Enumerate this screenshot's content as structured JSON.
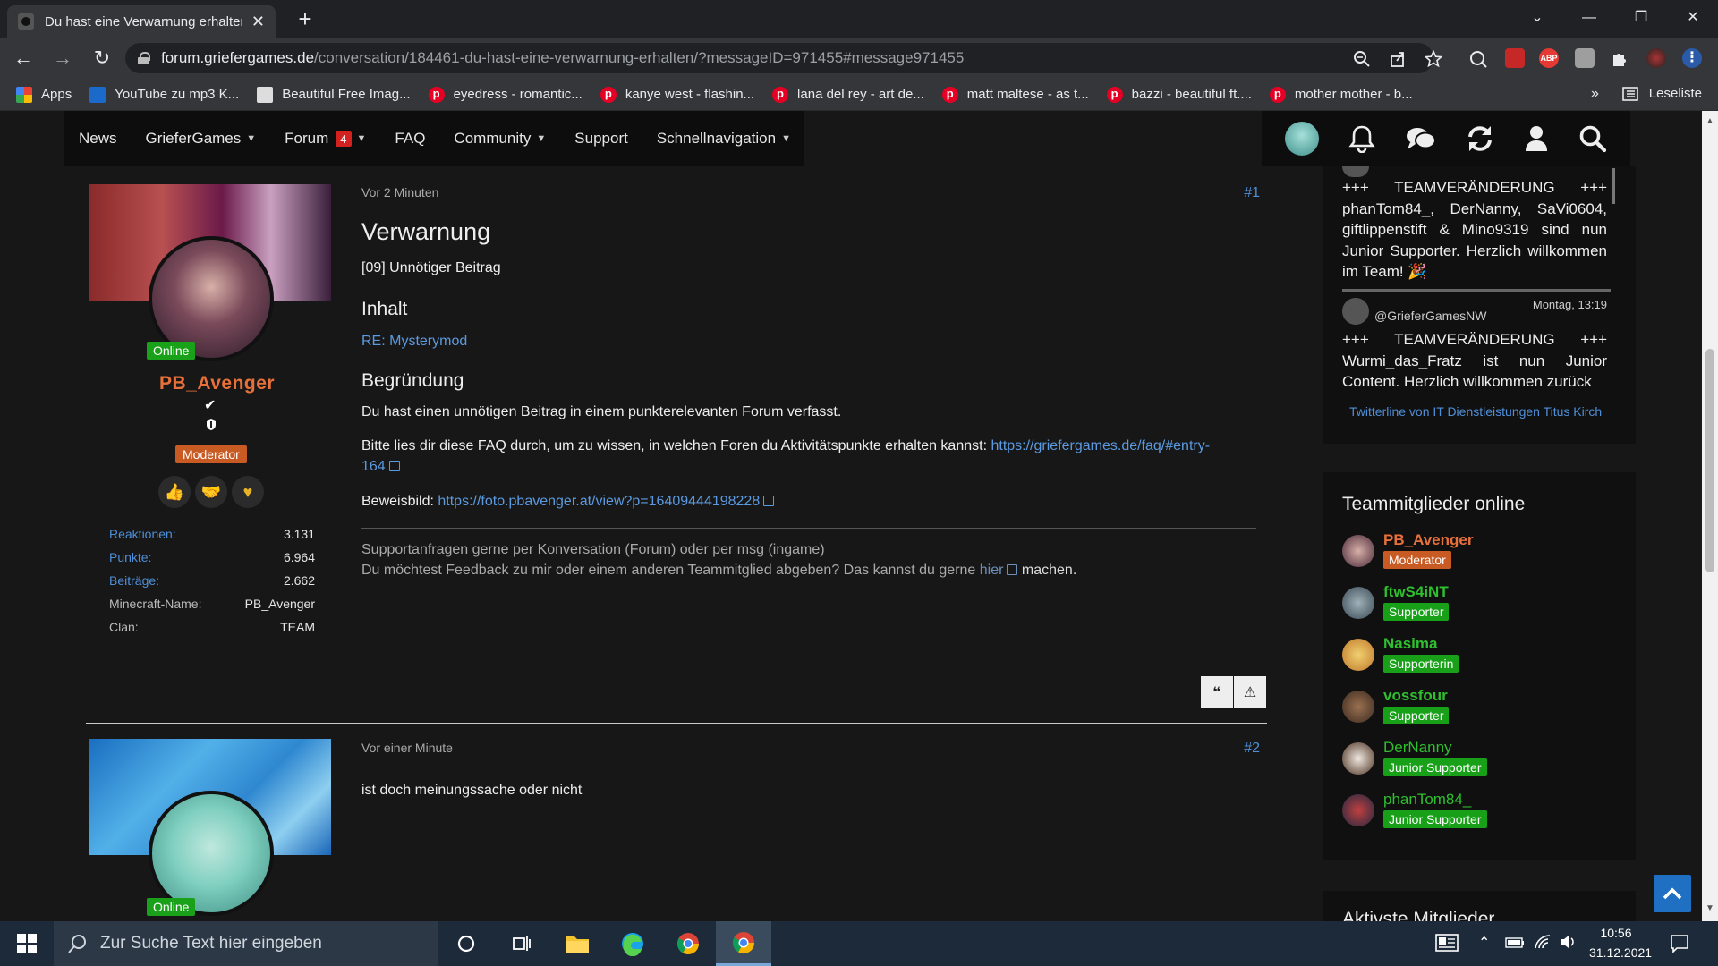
{
  "browser": {
    "tab_title": "Du hast eine Verwarnung erhalten",
    "url_host": "forum.griefergames.de",
    "url_path": "/conversation/184461-du-hast-eine-verwarnung-erhalten/?messageID=971455#message971455",
    "reading_list": "Leseliste",
    "bookmarks": [
      {
        "label": "Apps",
        "icon": "apps-grid-icon"
      },
      {
        "label": "YouTube zu mp3 K...",
        "icon": "2c-icon"
      },
      {
        "label": "Beautiful Free Imag...",
        "icon": "unsplash-icon"
      },
      {
        "label": "eyedress - romantic...",
        "icon": "pinterest-icon"
      },
      {
        "label": "kanye west - flashin...",
        "icon": "pinterest-icon"
      },
      {
        "label": "lana del rey - art de...",
        "icon": "pinterest-icon"
      },
      {
        "label": "matt maltese - as t...",
        "icon": "pinterest-icon"
      },
      {
        "label": "bazzi - beautiful ft....",
        "icon": "pinterest-icon"
      },
      {
        "label": "mother mother - b...",
        "icon": "pinterest-icon"
      }
    ],
    "bookmarks_more": "»"
  },
  "site_nav": {
    "items": [
      {
        "label": "News",
        "dropdown": false
      },
      {
        "label": "GrieferGames",
        "dropdown": true
      },
      {
        "label": "Forum",
        "dropdown": true,
        "badge": "4"
      },
      {
        "label": "FAQ",
        "dropdown": false
      },
      {
        "label": "Community",
        "dropdown": true
      },
      {
        "label": "Support",
        "dropdown": false
      },
      {
        "label": "Schnellnavigation",
        "dropdown": true
      }
    ]
  },
  "post1": {
    "time": "Vor 2 Minuten",
    "number": "#1",
    "online": "Online",
    "username": "PB_Avenger",
    "role": "Moderator",
    "stats": [
      {
        "k": "Reaktionen:",
        "v": "3.131"
      },
      {
        "k": "Punkte:",
        "v": "6.964"
      },
      {
        "k": "Beiträge:",
        "v": "2.662"
      },
      {
        "k": "Minecraft-Name:",
        "v": "PB_Avenger"
      },
      {
        "k": "Clan:",
        "v": "TEAM"
      }
    ],
    "title": "Verwarnung",
    "reason_code": "[09] Unnötiger Beitrag",
    "content_heading": "Inhalt",
    "content_link": "RE: Mysterymod",
    "justification_heading": "Begründung",
    "justification": "Du hast einen unnötigen Beitrag in einem punkterelevanten Forum verfasst.",
    "faq_text": "Bitte lies dir diese FAQ durch, um zu wissen, in welchen Foren du Aktivitätspunkte erhalten kannst: ",
    "faq_link_1": "https://griefergames.de/faq/#entry-",
    "faq_link_2": "164",
    "evidence_label": "Beweisbild: ",
    "evidence_link": "https://foto.pbavenger.at/view?p=16409444198228",
    "sig_line1": "Supportanfragen gerne per Konversation (Forum) oder per msg (ingame)",
    "sig_line2a": "Du möchtest Feedback zu mir oder einem anderen Teammitglied abgeben? Das kannst du gerne ",
    "sig_link": "hier",
    "sig_line2b": " machen.",
    "quote_glyph": "❝",
    "report_glyph": "⚠"
  },
  "post2": {
    "time": "Vor einer Minute",
    "number": "#2",
    "online": "Online",
    "text": "ist doch meinungssache oder nicht"
  },
  "twitter": {
    "tweet1": "+++ TEAMVERÄNDERUNG +++ phanTom84_, DerNanny, SaVi0604, giftlippenstift & Mino9319 sind nun Junior Supporter. Herzlich willkommen im Team! 🎉",
    "tweet2_handle": "@GrieferGamesNW",
    "tweet2_time": "Montag, 13:19",
    "tweet2": "+++ TEAMVERÄNDERUNG +++ Wurmi_das_Fratz ist nun Junior Content. Herzlich willkommen zurück",
    "credit": "Twitterline von IT Dienstleistungen Titus Kirch"
  },
  "team_online": {
    "heading": "Teammitglieder online",
    "members": [
      {
        "name": "PB_Avenger",
        "role": "Moderator",
        "name_color": "#e8703a",
        "badge_color": "#c85a23"
      },
      {
        "name": "ftwS4iNT",
        "role": "Supporter",
        "name_color": "#2fbf2f",
        "badge_color": "#18a018"
      },
      {
        "name": "Nasima",
        "role": "Supporterin",
        "name_color": "#2fbf2f",
        "badge_color": "#18a018"
      },
      {
        "name": "vossfour",
        "role": "Supporter",
        "name_color": "#2fbf2f",
        "badge_color": "#18a018"
      },
      {
        "name": "DerNanny",
        "role": "Junior Supporter",
        "name_color": "#2fbf2f",
        "badge_color": "#18a018"
      },
      {
        "name": "phanTom84_",
        "role": "Junior Supporter",
        "name_color": "#2fbf2f",
        "badge_color": "#18a018"
      }
    ],
    "next_heading": "Aktivste Mitglieder"
  },
  "taskbar": {
    "search_placeholder": "Zur Suche Text hier eingeben",
    "time": "10:56",
    "date": "31.12.2021"
  },
  "colors": {
    "link": "#5b9ae0",
    "moderator": "#e8703a",
    "supporter": "#18a018",
    "alert": "#d2211f"
  }
}
